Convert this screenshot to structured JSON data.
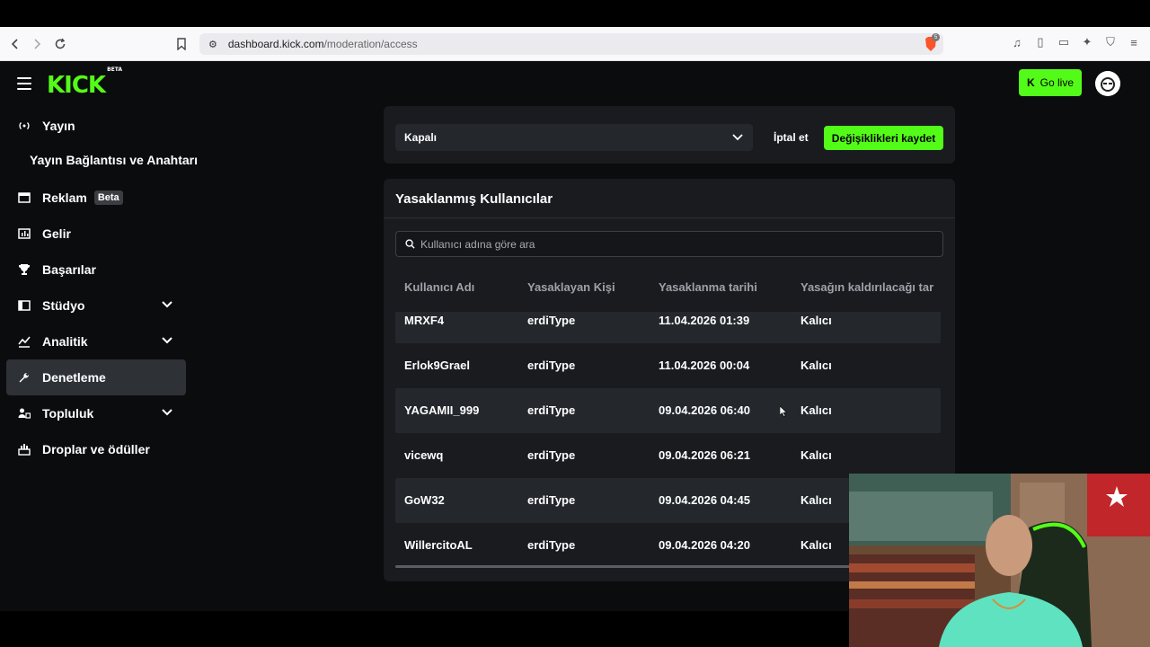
{
  "browser": {
    "url_host": "dashboard.kick.com",
    "url_path": "/moderation/access",
    "brave_badge": "5"
  },
  "header": {
    "logo_text": "KICK",
    "logo_badge": "BETA",
    "go_live_label": "Go live"
  },
  "sidebar": {
    "items": [
      {
        "label": "Yayın",
        "icon": "broadcast-icon"
      },
      {
        "label": "Yayın Bağlantısı ve Anahtarı",
        "sub": true
      },
      {
        "label": "Reklam",
        "icon": "ad-icon",
        "badge": "Beta"
      },
      {
        "label": "Gelir",
        "icon": "revenue-icon"
      },
      {
        "label": "Başarılar",
        "icon": "trophy-icon"
      },
      {
        "label": "Stüdyo",
        "icon": "studio-icon",
        "expandable": true
      },
      {
        "label": "Analitik",
        "icon": "chart-icon",
        "expandable": true
      },
      {
        "label": "Denetleme",
        "icon": "wrench-icon",
        "active": true
      },
      {
        "label": "Topluluk",
        "icon": "community-icon",
        "expandable": true
      },
      {
        "label": "Droplar ve ödüller",
        "icon": "drops-icon"
      }
    ]
  },
  "settings_panel": {
    "select_value": "Kapalı",
    "cancel_label": "İptal et",
    "save_label": "Değişiklikleri kaydet"
  },
  "banned_panel": {
    "title": "Yasaklanmış Kullanıcılar",
    "search_placeholder": "Kullanıcı adına göre ara",
    "columns": [
      "Kullanıcı Adı",
      "Yasaklayan Kişi",
      "Yasaklanma tarihi",
      "Yasağın kaldırılacağı tar"
    ],
    "rows": [
      [
        "MRXF4",
        "erdiType",
        "11.04.2026 01:39",
        "Kalıcı"
      ],
      [
        "Erlok9Grael",
        "erdiType",
        "11.04.2026 00:04",
        "Kalıcı"
      ],
      [
        "YAGAMII_999",
        "erdiType",
        "09.04.2026 06:40",
        "Kalıcı"
      ],
      [
        "vicewq",
        "erdiType",
        "09.04.2026 06:21",
        "Kalıcı"
      ],
      [
        "GoW32",
        "erdiType",
        "09.04.2026 04:45",
        "Kalıcı"
      ],
      [
        "WillercitoAL",
        "erdiType",
        "09.04.2026 04:20",
        "Kalıcı"
      ]
    ]
  },
  "colors": {
    "accent": "#53fc18",
    "background": "#0b0c0d",
    "panel": "#191b1f",
    "row_alt": "#24272c"
  }
}
